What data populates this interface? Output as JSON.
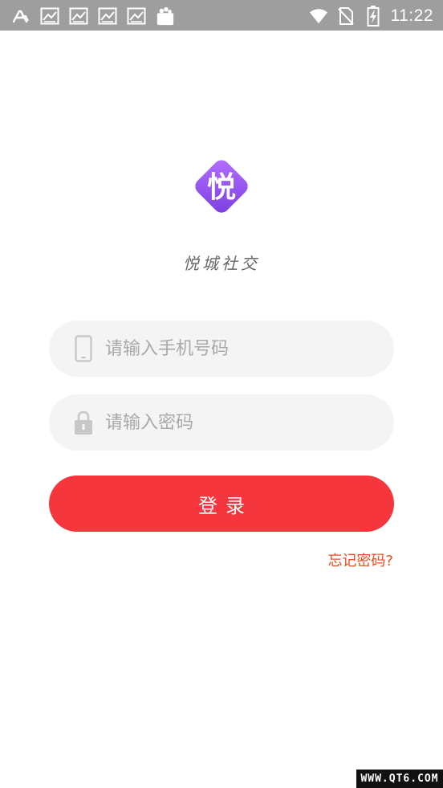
{
  "status_bar": {
    "time": "11:22",
    "left_icons": [
      "app-store-icon",
      "photo-icon",
      "photo-icon",
      "photo-icon",
      "photo-icon",
      "bag-icon"
    ],
    "right_icons": [
      "wifi-icon",
      "no-sim-icon",
      "battery-icon"
    ]
  },
  "logo": {
    "glyph": "悦",
    "gradient": [
      "#b06bff",
      "#7b3fe0"
    ]
  },
  "app_name": "悦城社交",
  "form": {
    "phone_placeholder": "请输入手机号码",
    "phone_value": "",
    "password_placeholder": "请输入密码",
    "password_value": "",
    "login_label": "登录",
    "forgot_label": "忘记密码?"
  },
  "colors": {
    "status_bar": "#9e9e9e",
    "field_bg": "#f4f4f4",
    "accent_red": "#f5363d",
    "forgot_orange": "#f04a1e"
  },
  "watermark": "WWW.QT6.COM"
}
